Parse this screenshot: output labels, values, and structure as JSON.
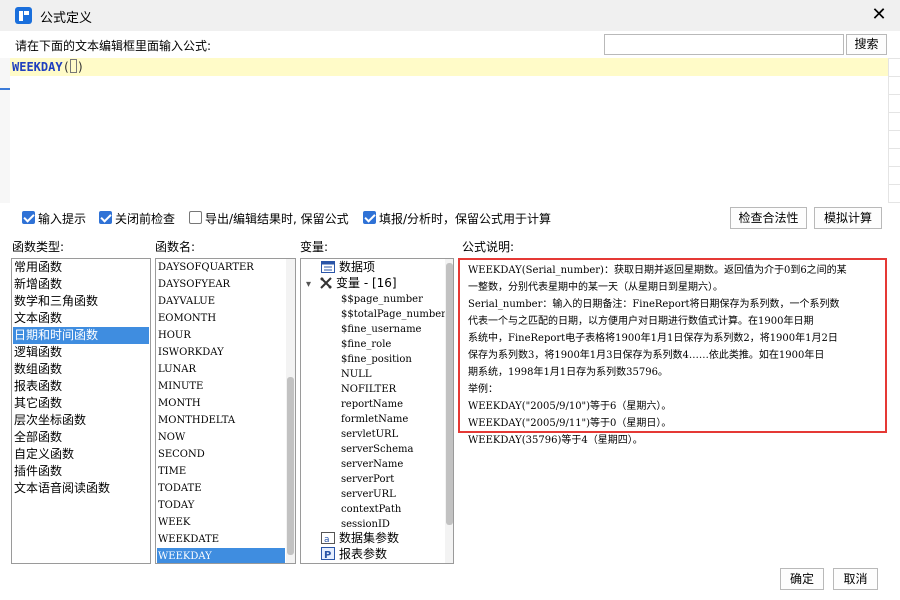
{
  "window": {
    "title": "公式定义",
    "close_glyph": "✕"
  },
  "prompt": {
    "label": "请在下面的文本编辑框里面输入公式:"
  },
  "search": {
    "value": "",
    "placeholder": "",
    "button": "搜索"
  },
  "editor": {
    "formula_name": "WEEKDAY",
    "open_paren": "(",
    "close_paren": ")"
  },
  "options": [
    {
      "label": "输入提示",
      "checked": true
    },
    {
      "label": "关闭前检查",
      "checked": true
    },
    {
      "label": "导出/编辑结果时, 保留公式",
      "checked": false
    },
    {
      "label": "填报/分析时，保留公式用于计算",
      "checked": true
    }
  ],
  "buttons": {
    "check": "检查合法性",
    "simulate": "模拟计算",
    "ok": "确定",
    "cancel": "取消"
  },
  "sections": {
    "categories": "函数类型:",
    "functions": "函数名:",
    "variables": "变量:",
    "description": "公式说明:"
  },
  "categories": {
    "items": [
      "常用函数",
      "新增函数",
      "数学和三角函数",
      "文本函数",
      "日期和时间函数",
      "逻辑函数",
      "数组函数",
      "报表函数",
      "其它函数",
      "层次坐标函数",
      "全部函数",
      "自定义函数",
      "插件函数",
      "文本语音阅读函数"
    ],
    "selected": 4
  },
  "functions": {
    "items": [
      "DAYSOFQUARTER",
      "DAYSOFYEAR",
      "DAYVALUE",
      "EOMONTH",
      "HOUR",
      "ISWORKDAY",
      "LUNAR",
      "MINUTE",
      "MONTH",
      "MONTHDELTA",
      "NOW",
      "SECOND",
      "TIME",
      "TODATE",
      "TODAY",
      "WEEK",
      "WEEKDATE",
      "WEEKDAY"
    ],
    "selected": 17
  },
  "variables": {
    "data_item": "数据项",
    "var_group": "变量 - [16]",
    "vars": [
      "$$page_number",
      "$$totalPage_number",
      "$fine_username",
      "$fine_role",
      "$fine_position",
      "NULL",
      "NOFILTER",
      "reportName",
      "formletName",
      "servletURL",
      "serverSchema",
      "serverName",
      "serverPort",
      "serverURL",
      "contextPath",
      "sessionID"
    ],
    "dataset_params": "数据集参数",
    "report_params": "报表参数",
    "expand_glyph": "▾",
    "icons": {
      "data_item": "table-icon",
      "var_group": "variable-x-icon",
      "dataset_params": "dataset-param-icon",
      "report_params": "report-param-icon"
    }
  },
  "description": {
    "lines": [
      "WEEKDAY(Serial_number)：获取日期并返回星期数。返回值为介于0到6之间的某",
      "一整数，分别代表星期中的某一天（从星期日到星期六）。",
      "Serial_number：输入的日期备注：FineReport将日期保存为系列数，一个系列数",
      "代表一个与之匹配的日期，以方便用户对日期进行数值式计算。在1900年日期",
      "系统中，FineReport电子表格将1900年1月1日保存为系列数2，将1900年1月2日",
      "保存为系列数3，将1900年1月3日保存为系列数4……依此类推。如在1900年日",
      "期系统，1998年1月1日存为系列数35796。",
      "举例：",
      "WEEKDAY(\"2005/9/10\")等于6（星期六）。",
      "WEEKDAY(\"2005/9/11\")等于0（星期日）。",
      "WEEKDAY(35796)等于4（星期四）。"
    ]
  },
  "colors": {
    "accent": "#3f8de0",
    "highlight_border": "#e53935",
    "editor_line": "#fffbc8",
    "formula": "#1f3fbf"
  }
}
